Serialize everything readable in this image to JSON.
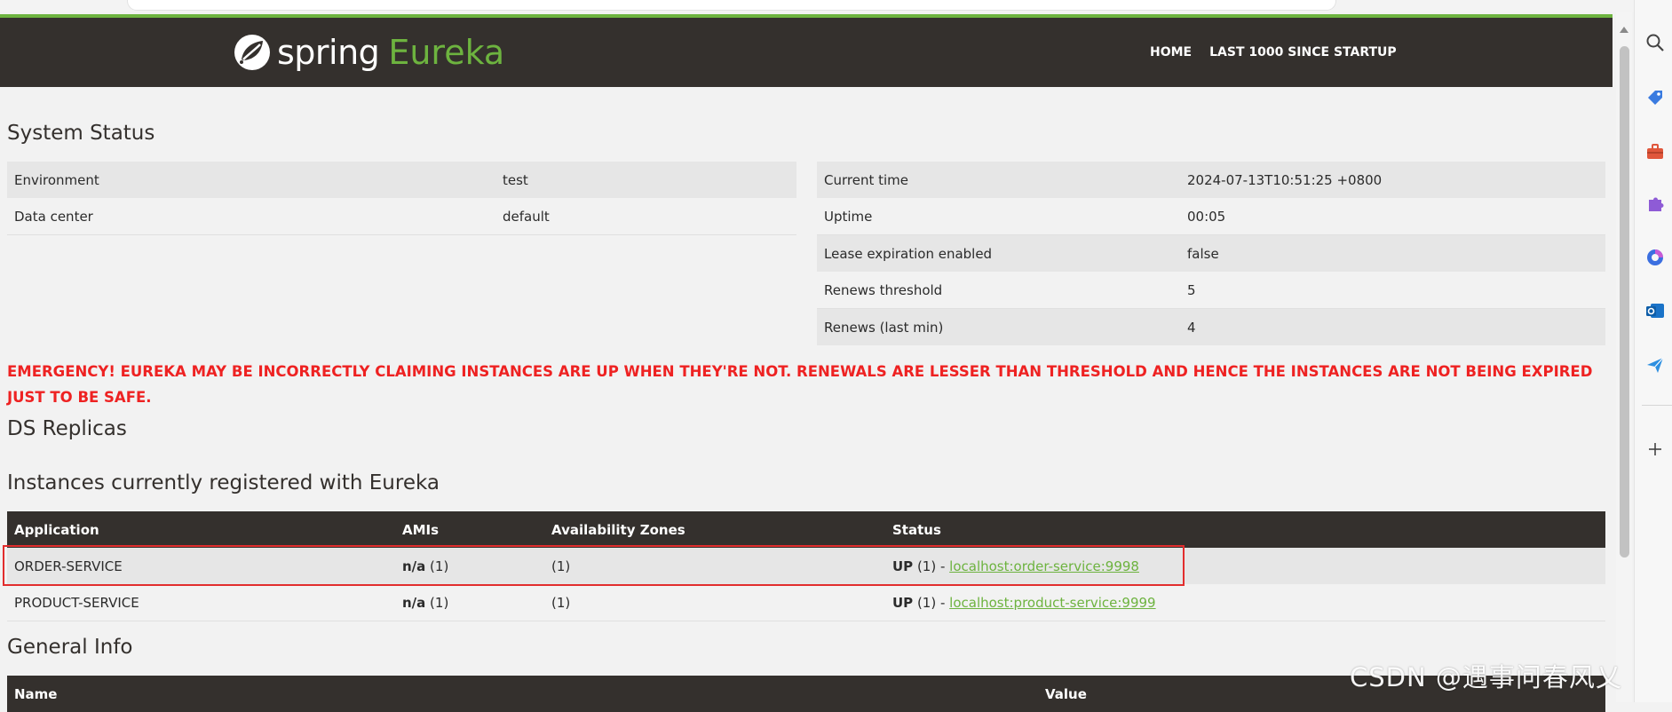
{
  "brand": {
    "spring": "spring",
    "eureka": "Eureka"
  },
  "nav": {
    "home": "HOME",
    "last1000": "LAST 1000 SINCE STARTUP"
  },
  "system_status": {
    "title": "System Status",
    "left": [
      {
        "label": "Environment",
        "value": "test"
      },
      {
        "label": "Data center",
        "value": "default"
      }
    ],
    "right": [
      {
        "label": "Current time",
        "value": "2024-07-13T10:51:25 +0800"
      },
      {
        "label": "Uptime",
        "value": "00:05"
      },
      {
        "label": "Lease expiration enabled",
        "value": "false"
      },
      {
        "label": "Renews threshold",
        "value": "5"
      },
      {
        "label": "Renews (last min)",
        "value": "4"
      }
    ]
  },
  "emergency": "EMERGENCY! EUREKA MAY BE INCORRECTLY CLAIMING INSTANCES ARE UP WHEN THEY'RE NOT. RENEWALS ARE LESSER THAN THRESHOLD AND HENCE THE INSTANCES ARE NOT BEING EXPIRED JUST TO BE SAFE.",
  "ds_replicas": {
    "title": "DS Replicas"
  },
  "instances": {
    "title": "Instances currently registered with Eureka",
    "headers": {
      "application": "Application",
      "amis": "AMIs",
      "zones": "Availability Zones",
      "status": "Status"
    },
    "rows": [
      {
        "application": "ORDER-SERVICE",
        "ami": "n/a",
        "ami_count": " (1)",
        "zones": "(1)",
        "status": "UP",
        "status_count": " (1) - ",
        "link": "localhost:order-service:9998"
      },
      {
        "application": "PRODUCT-SERVICE",
        "ami": "n/a",
        "ami_count": " (1)",
        "zones": "(1)",
        "status": "UP",
        "status_count": " (1) - ",
        "link": "localhost:product-service:9999"
      }
    ]
  },
  "general_info": {
    "title": "General Info",
    "headers": {
      "name": "Name",
      "value": "Value"
    }
  },
  "watermark": "CSDN @遇事问春风乂",
  "colors": {
    "navbar": "#34302d",
    "accent": "#6db33f",
    "emergency": "#ee2222",
    "highlight": "#e22d2d"
  },
  "side_panel": {
    "icons": [
      "search-icon",
      "tag-icon",
      "toolbox-icon",
      "puzzle-icon",
      "copilot-icon",
      "outlook-icon",
      "send-icon",
      "plus-icon"
    ]
  }
}
